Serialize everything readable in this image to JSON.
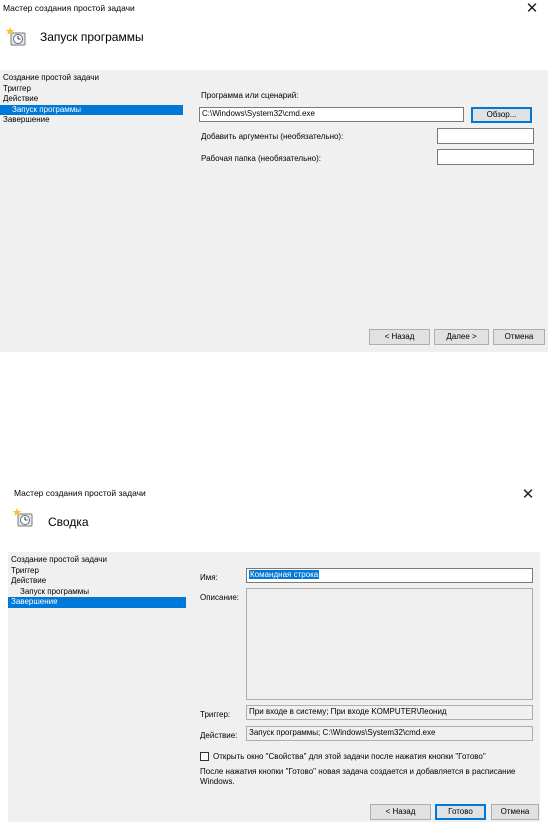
{
  "wizard1": {
    "window_title": "Мастер создания простой задачи",
    "header_title": "Запуск программы",
    "nav": [
      {
        "label": "Создание простой задачи"
      },
      {
        "label": "Триггер"
      },
      {
        "label": "Действие"
      },
      {
        "label": "Запуск программы",
        "selected": true
      },
      {
        "label": "Завершение"
      }
    ],
    "program_label": "Программа или сценарий:",
    "program_value": "C:\\Windows\\System32\\cmd.exe",
    "browse_label": "Обзор...",
    "args_label": "Добавить аргументы (необязательно):",
    "args_value": "",
    "workdir_label": "Рабочая папка (необязательно):",
    "workdir_value": "",
    "back_label": "< Назад",
    "next_label": "Далее >",
    "cancel_label": "Отмена"
  },
  "wizard2": {
    "window_title": "Мастер создания простой задачи",
    "header_title": "Сводка",
    "nav": [
      {
        "label": "Создание простой задачи"
      },
      {
        "label": "Триггер"
      },
      {
        "label": "Действие"
      },
      {
        "label": "Запуск программы"
      },
      {
        "label": "Завершение",
        "selected": true
      }
    ],
    "name_label": "Имя:",
    "name_value": "Командная строка",
    "description_label": "Описание:",
    "description_value": "",
    "trigger_label": "Триггер:",
    "trigger_value": "При входе в систему; При входе KOMPUTER\\Леонид",
    "action_label": "Действие:",
    "action_value": "Запуск программы; C:\\Windows\\System32\\cmd.exe",
    "open_properties_label": "Открыть окно \"Свойства\" для этой задачи после нажатия кнопки \"Готово\"",
    "open_properties_checked": false,
    "info_text": "После нажатия кнопки \"Готово\" новая задача создается и добавляется в расписание Windows.",
    "back_label": "< Назад",
    "finish_label": "Готово",
    "cancel_label": "Отмена"
  },
  "icons": {
    "close": "close-icon",
    "task": "task-scheduler-icon"
  },
  "colors": {
    "selection": "#0078d7",
    "panel": "#f0f0f0"
  }
}
